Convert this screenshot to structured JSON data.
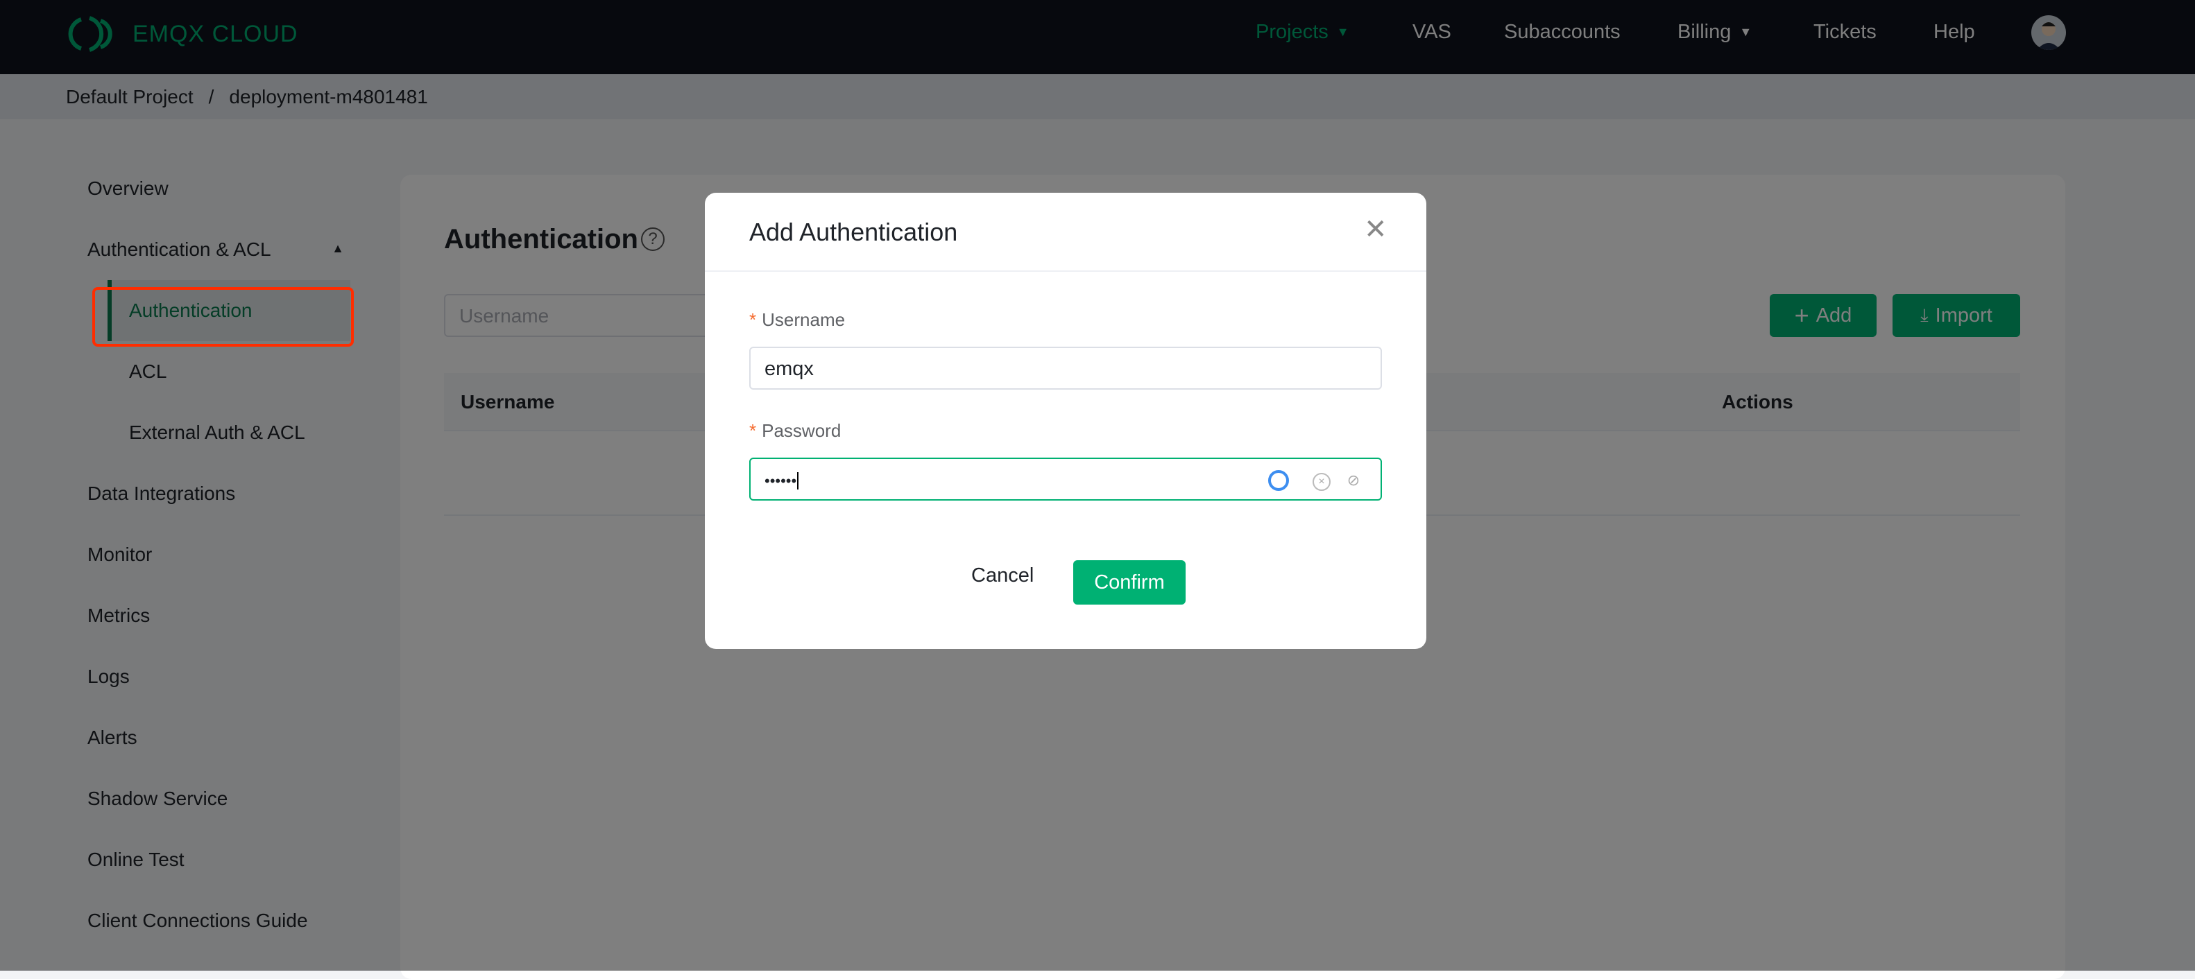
{
  "header": {
    "logo": "EMQX CLOUD",
    "nav": [
      "Projects",
      "VAS",
      "Subaccounts",
      "Billing",
      "Tickets",
      "Help"
    ],
    "accent": "#00b173"
  },
  "breadcrumb": [
    "Default Project",
    "/",
    "deployment-m4801481"
  ],
  "sidebar": {
    "items": [
      "Overview",
      "Authentication & ACL",
      "Authentication",
      "ACL",
      "External Auth & ACL",
      "Data Integrations",
      "Monitor",
      "Metrics",
      "Logs",
      "Alerts",
      "Shadow Service",
      "Online Test",
      "Client Connections Guide"
    ],
    "active": "Authentication"
  },
  "main": {
    "title": "Authentication",
    "search_placeholder": "Username",
    "add_label": "Add",
    "import_label": "Import",
    "columns": [
      "Username",
      "Actions"
    ]
  },
  "modal": {
    "title": "Add Authentication",
    "username_label": "Username",
    "username_value": "emqx",
    "password_label": "Password",
    "password_value": "••••••",
    "required_mark": "*",
    "cancel": "Cancel",
    "confirm": "Confirm"
  }
}
